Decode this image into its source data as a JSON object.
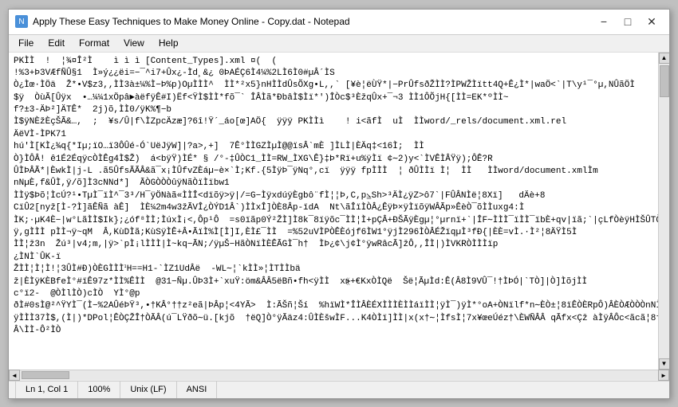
{
  "window": {
    "title": "Apply These Easy Techniques to Make Money Online - Copy.dat - Notepad",
    "icon": "N"
  },
  "menu": {
    "items": [
      "File",
      "Edit",
      "Format",
      "View",
      "Help"
    ]
  },
  "content": {
    "text": "PKÌÌ  !  ¦¾¤Î²Ì    ì ì ì [Content_Types].xml ¤(  (\n!%3+Þ3VÆfÑÛ§1  Ì»ý¿¿ëi=−¯^i7+Ûx¿-Ìd¸&¿ 0ÞAÉÇ6Ì4¼%2LÌ6Ì0#µÂ´ÌS\nÒ¿Ìœ·ÌÖä  Ž*•V$z3,,ÌÌ3à±¼%Ì−Þ%p)OµÌÌÌ^  ÌÌ*²x5}nHÌÌdÛsÕXg•L,,` [¥è¦ëÙŸ*|−PrÛfsðŽÌÌ?ÌPWŽÌïtt4Q+Ê¿Ì*|waÖ<`|T\\y¹¯°µ,NÛãÖÌ\n$ÿ  ÒùÃ[Ûÿx  •…¼¼1xÖpâ►àëfÿÊ#I)Ëf<ŸÌ$ÌÌ*fõ¯` ÎÂÌã*ÐbâÌ$Ìï*')ÎÒc$³ÈžqÛx+¯¬3 ÌÌ1ÔÕjH{[ÌÌ=EK*ºÌÌ~\nf?±3-ÄÞ²]ÄTÊ*  2j)õ,ÌÌ0/ÿK%¶−b\nÌ$ÿNÈžÈçŠÃ&…,  ;  ¥s/Û|f\\ÌZpcÄzæ]?6î!Ÿ´_áo[œ]AÖ{  ÿÿÿ PKÌÌì    ! i<ãfÌ  uÌ  ÌÌword/_rels/document.xml.rel\nÄëVÌ-ÌPK71\nhú'Ì[KÌ¿¾q{*Iµ;ïO…ï3ÔÛé-Ó`UëJÿW]|?a>,+]  7Ê°ÌÌGZÌµÌ@@ïsÂ`mÈ ]ÌLÌ|ÈÄq‡<16Ì;  ÌÌ\nÒ}ÌÔÂ! ê1É2ÉqÿcÒÌÊg4Ì$Ž)  á<bÿŸ)ÌÉ* § /°-‡ÛÒC1_ÌÌ=RW_ÌXG\\Ê}‡Þ*Rï+u%ÿÌï ¢∼2)y<`ÌVÊÌÂŸÿ);ÔÊ?R\nÛÌÞÂÃ*|ÈwkÌ|j-L .ã5ÛfsÃÃÂ&ã¯x¡ÌÛfvZÈáµ−è×`Ì;Kf.{5ÌÿÞ¯ÿNq°,cï  ÿÿÿ fpÌÌÌ  ¦ ðÛÌÌï Ì¦  ÌÌ   ÌÌword/document.xmlÌm\nnNµÈ,f&ÛÌ,ÿ/õ]Ì3cNNd*]  ÃÒGÒÒÒûÿNãÒïÌïbw1\nÌÌÿ$Þõ¦ÌcÚ?¹•TµÌ¯ïÌ^¯3³/H¯ÿÖNàã«ÌÌÎ<dïõÿ>ÿ|/=G−ÌÿxdúÿÈgbô¨fÌ¦¦Þ,C,p⦥Sh>³ÄÌ¿ÿZ>ô7`|FÛÂNÌë¦8Xï]   dÄè+8\nCïÛ2[nyž[Ì-?Ì]ãÊÑã àÊ]  ÌÈ¼2m4w3žÃVÎ¿ÒÝD1Â`)ÌÌxÎ]ÒÈ8Âp-ïdA  Nt\\ãÎïÌÒÂ¿ÊÿÞ×ÿÌïõÿWÂÃp»ÊèÒ¯õÌÌuxg4:Ì\nÌK;·µK4È−|w°LãÌÌ$Ik};¿óf⁸ÌÌ;ÌúxÌ¡<,Ôp¹Ô  =s0ïãp0Ý²ŽÌ]Ì8k¯8ïÿõc¯ÌÌ¦Ì+pÇÂ+ÐŠÃÿÈgµ¦°µrnï+`|ÎF∼ÌÌÌ¯ïÌÌ¯ïbÈ+qv|ïã;`|çLfÒèÿHÌŠÛTÒÌ\nÿ,gÌÌÌ pÌÌ¬ÿ~qM  Â,KùDÌã;KùSÿÌÊ+Â•ÃïÌ%Ì[Ì]I,ÈÌ£¯ÌÌ  =%52uVÌPÒÊÈójf6ÌW1°ÿjÌ296ÌÒÂÉŽïqµÌ³fÐ{|ÈÈ=vÌ.·Ì²¦8ÄŸÌ5Ì\nÌÌ¦ž3n  Žú³|v4;m,|ÿ>`pÌ¡lÌÌÌ|Ì~kq−ÃN;/ÿµŠ−HãÒNïÌÈÊÃGÌ¯h†  ÌÞ¿¢\\j¢Ì°ÿwRâcÃ]žÔ,,ÎÌ|)ÌVKRÒÌÌÌïp\n¿ÌNÌ`ÛK-ï\nŽÌÌ¦Ì¦Ì!¦3ÛÌ#Ð)ÒÈGÌÌÌᣳH==H1-`ÌZ1UdÂë  -WL∼¦`kÌÌ»¦ÌTÌÌbä\nž|ÈÌÿKÈBfeÌ°#ïÊ97z*ÌÌ%ÊÌÌ  @31−Ñµ.ÛÞ3Ì+`xuŸ:öm&ÂÂ5ëBñ•fh<ÿÌÌ  x⦕+€KxÒÌQë  Šë¦ÃµÌd:Ê(Â8Ì9VÛ¯!†ÌÞÓ|`TÒ]|Ò]ÌõjÌÌ\nc°ï2-  @ÒÌlÌÒ)cÌÒ  YÌ°@p\nðÌ#0sÌ@²^ŸYÌ¯(Ì−%2AÛéÞŸ³,•†KÂ°††z²eã|ÞÂp¦<4YÃ>  Ì:ÃŠñ¦Ší  %hïWÌ*ÎÌÂÈÉXÌÌÌÈÌÌáïÌÌ¦ÿÌ¯)ÿÌ*°oA+ÒNïlf*n∼ÈÒ±¦8ïÊÒÈRpÔ)ÂÈÒÆÒÒÒnNÌÌ\nÿÌÌÌ37Ì$,(Ì|)*DPol¦ÊÒÇŽÎ†ÒÃÂ(ú¯LŸðõ∼ü.[kjõ  †ëQ]Ò°ÿÃäz4:ÛÌÈšwÌF...K4ÒÌï]ÌÌ|x(x†∼¦ÌfsÌ¦7x¥œeÚéz†\\ÈWÑÂÂqÃfx<Çž àÌÿÂÔc<ãcã¦8†−ÊÌÒ\nÂ\\ÌÌ-Ô²ÌÒ"
  },
  "status_bar": {
    "line_col": "Ln 1, Col 1",
    "zoom": "100%",
    "line_ending": "Unix (LF)",
    "encoding": "ANSI"
  }
}
